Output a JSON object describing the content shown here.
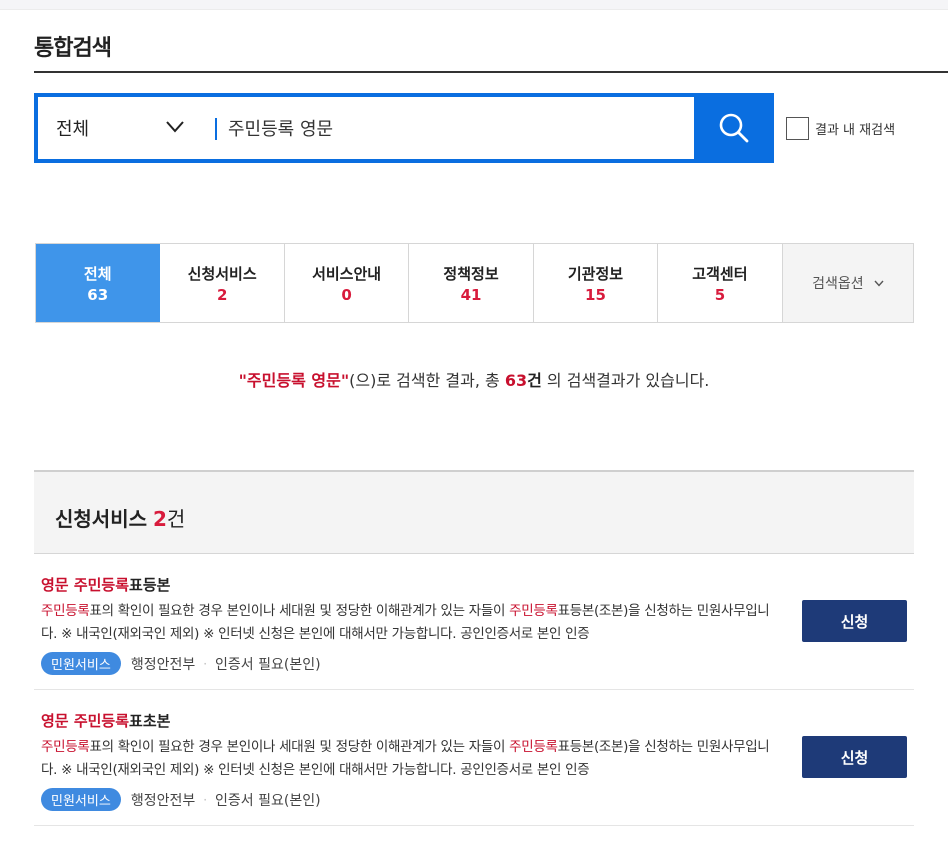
{
  "page": {
    "title": "통합검색"
  },
  "search": {
    "scope": "전체",
    "query": "주민등록 영문",
    "research_label": "결과 내 재검색"
  },
  "tabs": [
    {
      "label": "전체",
      "count": "63"
    },
    {
      "label": "신청서비스",
      "count": "2"
    },
    {
      "label": "서비스안내",
      "count": "0"
    },
    {
      "label": "정책정보",
      "count": "41"
    },
    {
      "label": "기관정보",
      "count": "15"
    },
    {
      "label": "고객센터",
      "count": "5"
    }
  ],
  "search_option_label": "검색옵션",
  "summary": {
    "keyword": "\"주민등록 영문\"",
    "middle": "(으)로 검색한 결과, 총 ",
    "total": "63",
    "unit": "건",
    "tail": " 의 검색결과가 있습니다."
  },
  "section": {
    "title": "신청서비스",
    "count": "2",
    "unit": "건"
  },
  "results": [
    {
      "title_hl": "영문 주민등록",
      "title_rest": "표등본",
      "desc": [
        {
          "hl": "주민등록"
        },
        {
          "t": "표의 확인이 필요한 경우 본인이나 세대원 및 정당한 이해관계가 있는 자들이 "
        },
        {
          "hl": "주민등록"
        },
        {
          "t": "표등본(조본)을 신청하는 민원사무입니다. ※ 내국인(재외국인 제외) ※ 인터넷 신청은 본인에 대해서만 가능합니다. 공인인증서로 본인 인증"
        }
      ],
      "badge": "민원서비스",
      "org": "행정안전부",
      "cert": "인증서 필요(본인)",
      "button": "신청"
    },
    {
      "title_hl": "영문 주민등록",
      "title_rest": "표초본",
      "desc": [
        {
          "hl": "주민등록"
        },
        {
          "t": "표의 확인이 필요한 경우 본인이나 세대원 및 정당한 이해관계가 있는 자들이 "
        },
        {
          "hl": "주민등록"
        },
        {
          "t": "표등본(조본)을 신청하는 민원사무입니다. ※ 내국인(재외국인 제외) ※ 인터넷 신청은 본인에 대해서만 가능합니다. 공인인증서로 본인 인증"
        }
      ],
      "badge": "민원서비스",
      "org": "행정안전부",
      "cert": "인증서 필요(본인)",
      "button": "신청"
    }
  ]
}
